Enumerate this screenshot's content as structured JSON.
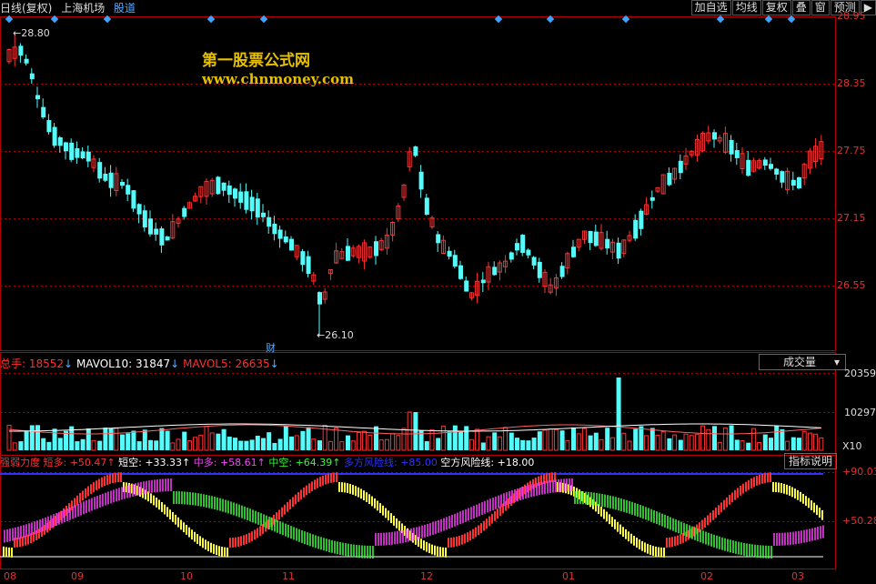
{
  "header": {
    "period": "日线(复权)",
    "market": "上海机场",
    "link": "股道"
  },
  "toolbar": [
    "加自选",
    "均线",
    "复权",
    "叠",
    "窗",
    "预测",
    "▶"
  ],
  "price_axis": [
    "28.95",
    "28.35",
    "27.75",
    "27.15",
    "26.55"
  ],
  "annotations": {
    "high": "28.80",
    "low": "26.10",
    "fin": "财"
  },
  "watermark": {
    "line1": "第一股票公式网",
    "line2": "www.chnmoney.com"
  },
  "volume_panel": {
    "label1": "总手: 18552",
    "label2": "MAVOL10: 31847",
    "label3": "MAVOL5: 26635",
    "arrow": "↓",
    "selector": "成交量",
    "axis": [
      "20359",
      "10297"
    ],
    "unit": "X10"
  },
  "indicator_panel": {
    "name": "强弱力度",
    "items": [
      {
        "text": "短多: +50.47",
        "color": "#ff3030"
      },
      {
        "text": "短空: +33.33",
        "color": "#ffffff"
      },
      {
        "text": "中多: +58.61",
        "color": "#ff40ff"
      },
      {
        "text": "中空: +64.39",
        "color": "#30ff30"
      },
      {
        "text": "多方风险线: +85.00",
        "color": "#3030ff"
      },
      {
        "text": "空方风险线: +18.00",
        "color": "#ffffff"
      }
    ],
    "button": "指标说明",
    "axis": [
      "+90.03",
      "+50.28"
    ]
  },
  "dates": [
    "08",
    "09",
    "10",
    "11",
    "12",
    "01",
    "02",
    "03"
  ],
  "colors": {
    "up": "#ff3232",
    "down": "#54fcfc",
    "grid": "#b00000",
    "axis": "#d33"
  }
}
